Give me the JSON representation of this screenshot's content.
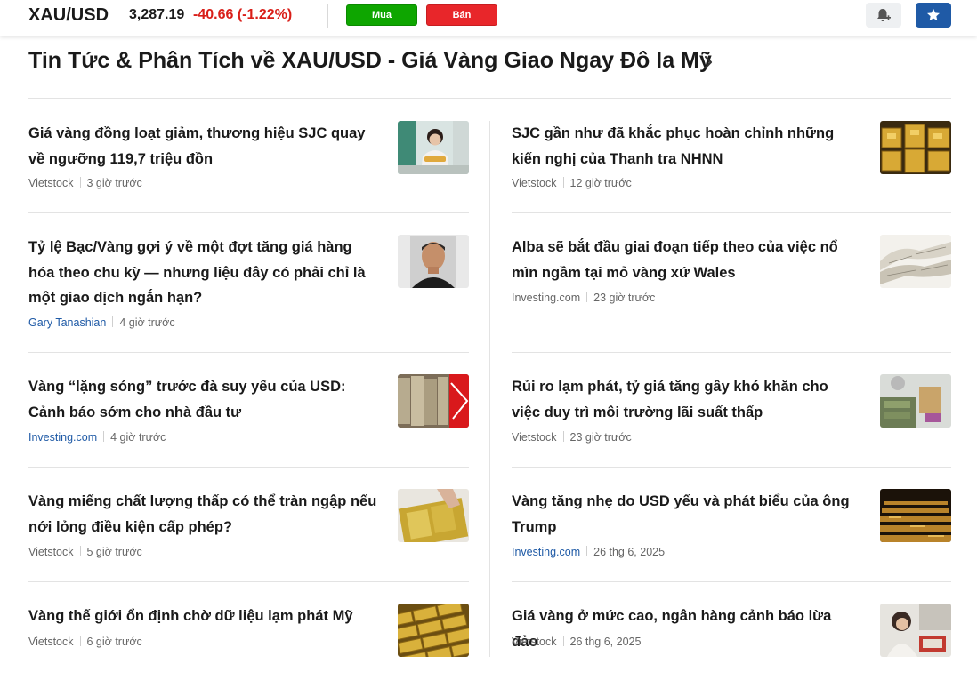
{
  "ticker": {
    "symbol": "XAU/USD",
    "price": "3,287.19",
    "change": "-40.66",
    "change_pct": "(-1.22%)",
    "buy_label": "Mua",
    "sell_label": "Bán",
    "colors": {
      "up": "#0ea600",
      "down": "#d91e18",
      "accent": "#1f5aa6"
    }
  },
  "section": {
    "title": "Tin Tức & Phân Tích về XAU/USD - Giá Vàng Giao Ngay Đô la Mỹ"
  },
  "articles_left": [
    {
      "title": "Giá vàng đồng loạt giảm, thương hiệu SJC quay về ngưỡng 119,7 triệu đồn",
      "source": "Vietstock",
      "time": "3 giờ trước",
      "source_is_link": false
    },
    {
      "title": "Tỷ lệ Bạc/Vàng gợi ý về một đợt tăng giá hàng hóa theo chu kỳ — nhưng liệu đây có phải chỉ là một giao dịch ngắn hạn?",
      "source": "Gary Tanashian",
      "time": "4 giờ trước",
      "source_is_link": true
    },
    {
      "title": "Vàng “lặng sóng” trước đà suy yếu của USD: Cảnh báo sớm cho nhà đầu tư",
      "source": "Investing.com",
      "time": "4 giờ trước",
      "source_is_link": true
    },
    {
      "title": "Vàng miếng chất lượng thấp có thể tràn ngập nếu nới lỏng điều kiện cấp phép?",
      "source": "Vietstock",
      "time": "5 giờ trước",
      "source_is_link": false
    },
    {
      "title": "Vàng thế giới ổn định chờ dữ liệu lạm phát Mỹ",
      "source": "Vietstock",
      "time": "6 giờ trước",
      "source_is_link": false
    }
  ],
  "articles_right": [
    {
      "title": "SJC gần như đã khắc phục hoàn chỉnh những kiến nghị của Thanh tra NHNN",
      "source": "Vietstock",
      "time": "12 giờ trước",
      "source_is_link": false
    },
    {
      "title": "Alba sẽ bắt đầu giai đoạn tiếp theo của việc nổ mìn ngầm tại mỏ vàng xứ Wales",
      "source": "Investing.com",
      "time": "23 giờ trước",
      "source_is_link": false
    },
    {
      "title": "Rủi ro lạm phát, tỷ giá tăng gây khó khăn cho việc duy trì môi trường lãi suất thấp",
      "source": "Vietstock",
      "time": "23 giờ trước",
      "source_is_link": false
    },
    {
      "title": "Vàng tăng nhẹ do USD yếu và phát biểu của ông Trump",
      "source": "Investing.com",
      "time": "26 thg 6, 2025",
      "source_is_link": true
    },
    {
      "title": "Giá vàng ở mức cao, ngân hàng cảnh báo lừa đảo",
      "source": "Vietstock",
      "time": "26 thg 6, 2025",
      "source_is_link": false
    }
  ]
}
